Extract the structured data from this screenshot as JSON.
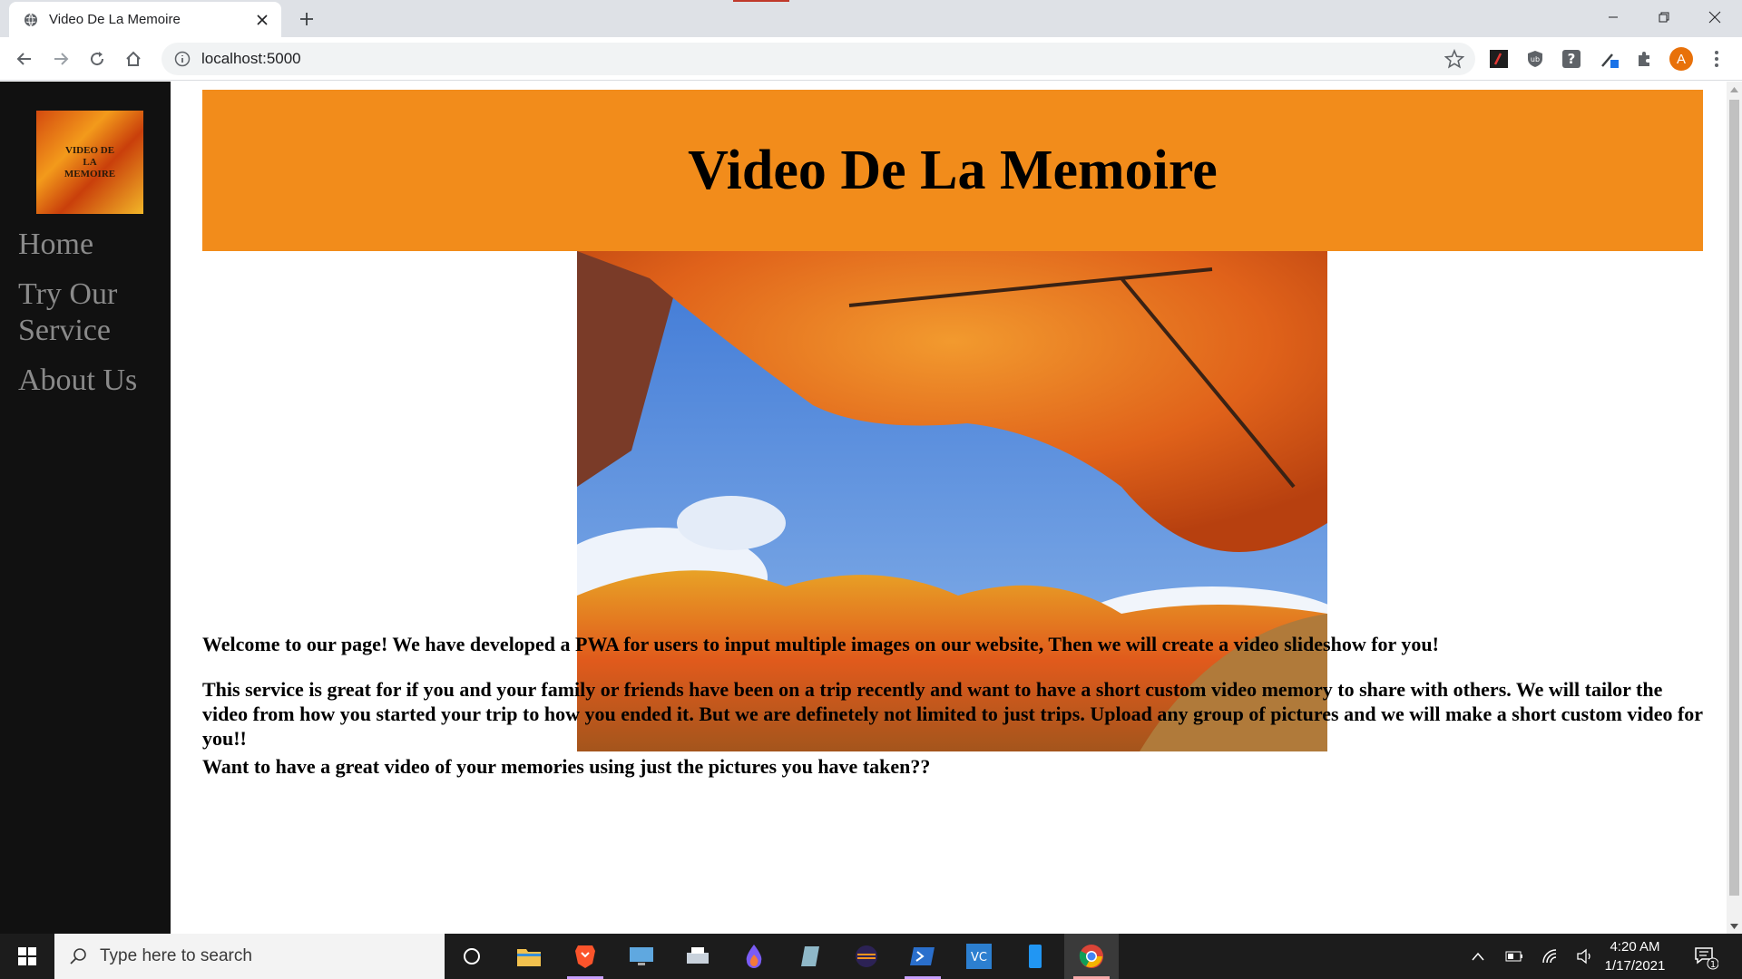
{
  "browser": {
    "tab_title": "Video De La Memoire",
    "new_tab": "+",
    "url": "localhost:5000",
    "profile_initial": "A"
  },
  "sidebar": {
    "logo_text": "VIDEO DE LA MEMOIRE",
    "nav": [
      {
        "label": "Home"
      },
      {
        "label": "Try Our Service"
      },
      {
        "label": "About Us"
      }
    ]
  },
  "main": {
    "heading": "Video De La Memoire",
    "paragraphs": [
      "Welcome to our page! We have developed a PWA for users to input multiple images on our website, Then we will create a video slideshow for you!",
      "This service is great for if you and your family or friends have been on a trip recently and want to have a short custom video memory to share with others. We will tailor the video from how you started your trip to how you ended it. But we are definetely not limited to just trips. Upload any group of pictures and we will make a short custom video for you!!",
      "Want to have a great video of your memories using just the pictures you have taken??"
    ]
  },
  "taskbar": {
    "search_placeholder": "Type here to search",
    "time": "4:20 AM",
    "date": "1/17/2021",
    "notification_count": "1"
  },
  "colors": {
    "banner": "#f28c1b",
    "sidebar_bg": "#111111",
    "nav_text": "#8a8a8a",
    "profile": "#e8710a"
  },
  "icons": [
    "globe-icon",
    "close-icon",
    "back-icon",
    "forward-icon",
    "reload-icon",
    "home-icon",
    "info-icon",
    "star-icon",
    "extensions-icon",
    "menu-icon",
    "windows-start-icon",
    "search-icon",
    "cortana-icon",
    "file-explorer-icon",
    "brave-icon",
    "chrome-icon"
  ]
}
